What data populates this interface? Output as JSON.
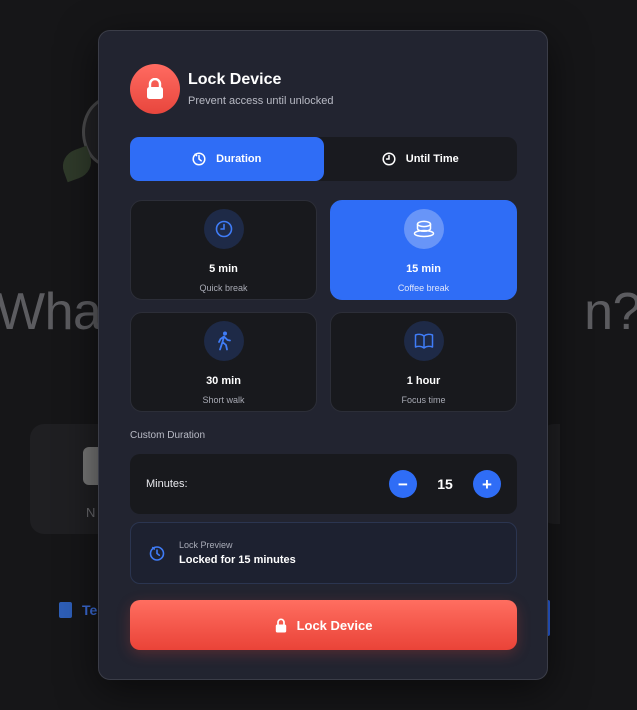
{
  "background": {
    "headline_left": "Wha",
    "headline_right": "n?",
    "card_label": "N",
    "doc_label": "Te"
  },
  "modal": {
    "title": "Lock Device",
    "subtitle": "Prevent access until unlocked",
    "header_icon": "lock-icon",
    "tabs": [
      {
        "label": "Duration",
        "icon": "timer-icon",
        "active": true
      },
      {
        "label": "Until Time",
        "icon": "clock-icon",
        "active": false
      }
    ],
    "options": [
      {
        "title": "5 min",
        "subtitle": "Quick break",
        "icon": "clock-icon",
        "selected": false
      },
      {
        "title": "15 min",
        "subtitle": "Coffee break",
        "icon": "coffee-icon",
        "selected": true
      },
      {
        "title": "30 min",
        "subtitle": "Short walk",
        "icon": "walking-icon",
        "selected": false
      },
      {
        "title": "1 hour",
        "subtitle": "Focus time",
        "icon": "book-icon",
        "selected": false
      }
    ],
    "custom": {
      "section_label": "Custom Duration",
      "field_label": "Minutes:",
      "value": "15",
      "decrement": "−",
      "increment": "+"
    },
    "preview": {
      "label": "Lock Preview",
      "value": "Locked for 15 minutes",
      "icon": "timer-icon"
    },
    "lock_button": {
      "label": "Lock Device",
      "icon": "lock-icon"
    }
  },
  "colors": {
    "accent": "#2f6df6",
    "danger": "#ea4338",
    "modal_bg": "#222430",
    "tile_bg": "#18191d"
  }
}
